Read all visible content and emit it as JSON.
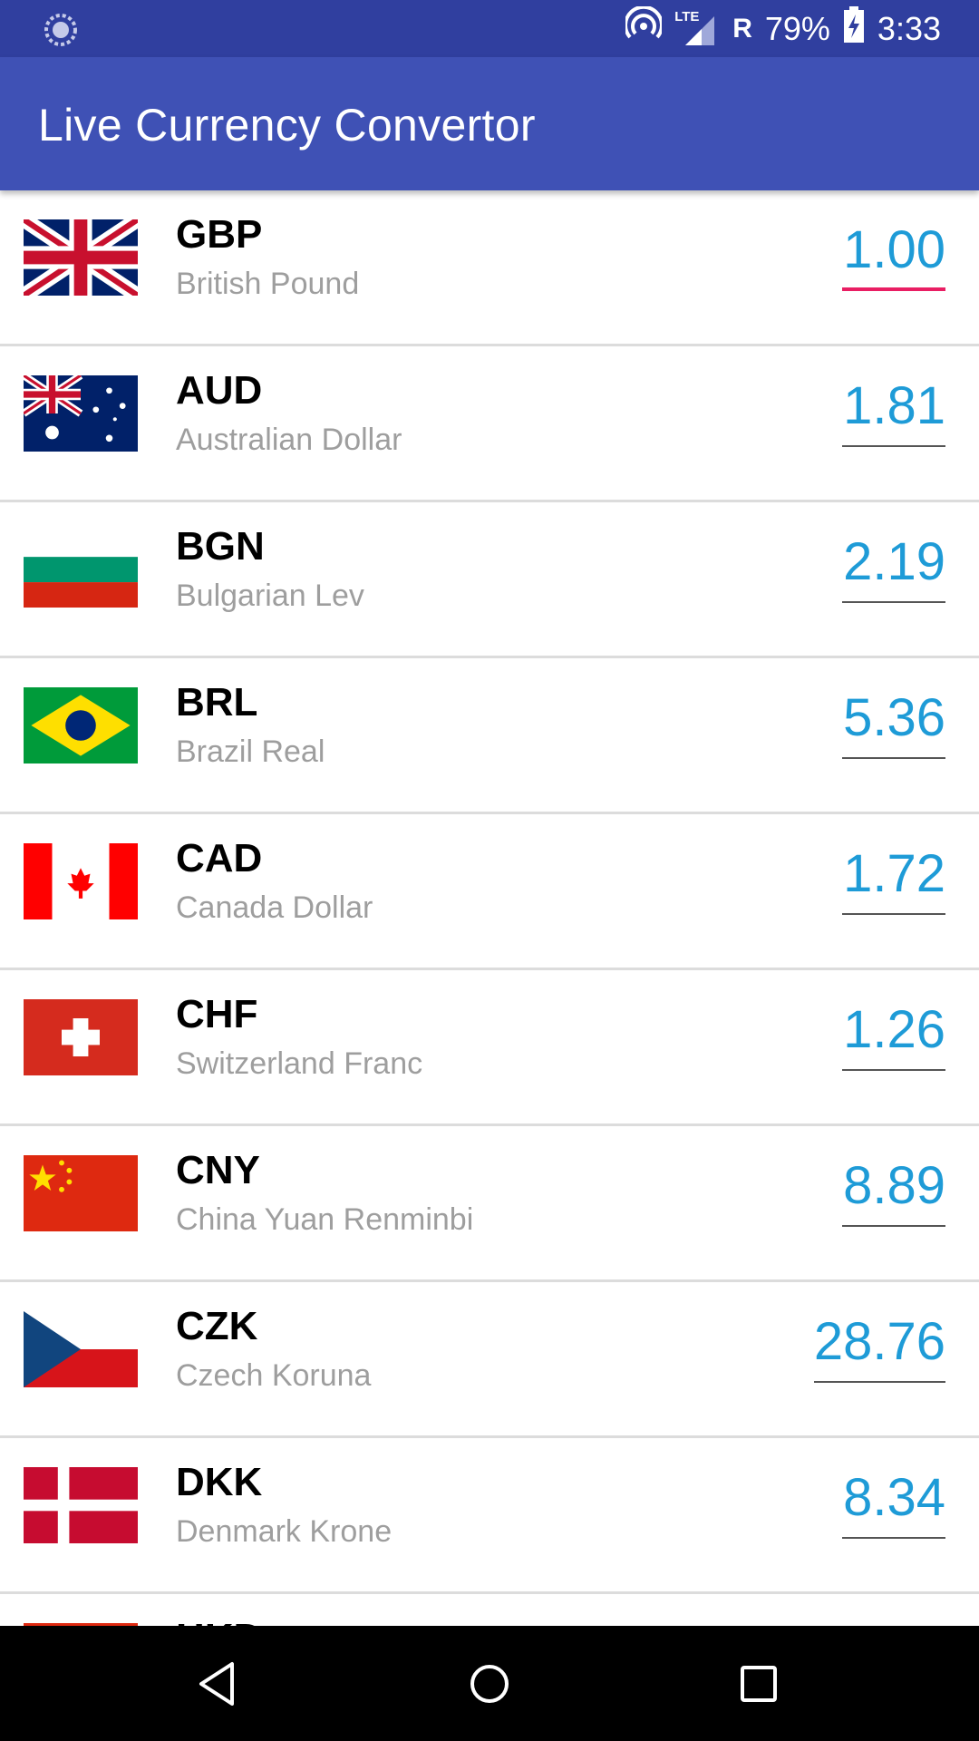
{
  "status": {
    "battery": "79%",
    "time": "3:33",
    "network": "LTE",
    "roaming": "R"
  },
  "appbar": {
    "title": "Live Currency Convertor"
  },
  "currencies": [
    {
      "code": "GBP",
      "name": "British Pound",
      "value": "1.00"
    },
    {
      "code": "AUD",
      "name": "Australian Dollar",
      "value": "1.81"
    },
    {
      "code": "BGN",
      "name": "Bulgarian Lev",
      "value": "2.19"
    },
    {
      "code": "BRL",
      "name": "Brazil Real",
      "value": "5.36"
    },
    {
      "code": "CAD",
      "name": "Canada Dollar",
      "value": "1.72"
    },
    {
      "code": "CHF",
      "name": "Switzerland Franc",
      "value": "1.26"
    },
    {
      "code": "CNY",
      "name": "China Yuan Renminbi",
      "value": "8.89"
    },
    {
      "code": "CZK",
      "name": "Czech Koruna",
      "value": "28.76"
    },
    {
      "code": "DKK",
      "name": "Denmark Krone",
      "value": "8.34"
    },
    {
      "code": "HKD",
      "name": "",
      "value": ""
    }
  ],
  "colors": {
    "status_bar": "#303F9F",
    "appbar": "#3F51B5",
    "amount_text": "#1E9BD7",
    "focus_underline": "#E91E63"
  }
}
